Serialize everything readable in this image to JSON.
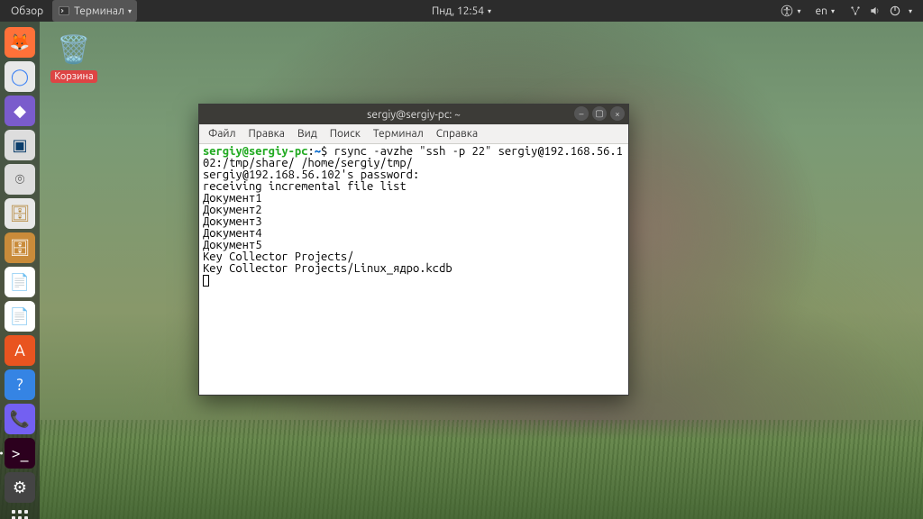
{
  "topbar": {
    "activities": "Обзор",
    "app_indicator": "Терминал",
    "clock": "Пнд, 12:54",
    "lang": "en"
  },
  "desktop": {
    "trash_label": "Корзина"
  },
  "dock": {
    "items": [
      {
        "name": "firefox",
        "bg": "#ff7139",
        "glyph": "🦊"
      },
      {
        "name": "chromium",
        "bg": "#e8e8e8",
        "glyph": "◯",
        "fg": "#4285f4"
      },
      {
        "name": "gnome-app",
        "bg": "#7a5ccc",
        "glyph": "◆"
      },
      {
        "name": "virtualbox",
        "bg": "#ddd",
        "glyph": "▣",
        "fg": "#0a3d6b"
      },
      {
        "name": "disks",
        "bg": "#ddd",
        "glyph": "⌾",
        "fg": "#555"
      },
      {
        "name": "files",
        "bg": "#e8e8e8",
        "glyph": "🗄",
        "fg": "#b58638"
      },
      {
        "name": "archive",
        "bg": "#c98b3a",
        "glyph": "🗄"
      },
      {
        "name": "writer",
        "bg": "#fff",
        "glyph": "📄",
        "fg": "#1565c0"
      },
      {
        "name": "impress",
        "bg": "#fff",
        "glyph": "📄",
        "fg": "#1565c0"
      },
      {
        "name": "software",
        "bg": "#e95420",
        "glyph": "A"
      },
      {
        "name": "help",
        "bg": "#3584e4",
        "glyph": "?"
      },
      {
        "name": "viber",
        "bg": "#7360f2",
        "glyph": "📞"
      },
      {
        "name": "terminal",
        "bg": "#2c001e",
        "glyph": ">_",
        "running": true
      },
      {
        "name": "settings",
        "bg": "#444",
        "glyph": "⚙"
      }
    ]
  },
  "terminal": {
    "title": "sergiy@sergiy-pc: ~",
    "menu": [
      "Файл",
      "Правка",
      "Вид",
      "Поиск",
      "Терминал",
      "Справка"
    ],
    "prompt_user": "sergiy@sergiy-pc",
    "prompt_sep": ":",
    "prompt_path": "~",
    "prompt_end": "$ ",
    "command": "rsync -avzhe \"ssh -p 22\" sergiy@192.168.56.102:/tmp/share/ /home/sergiy/tmp/",
    "output": [
      "sergiy@192.168.56.102's password:",
      "receiving incremental file list",
      "Документ1",
      "Документ2",
      "Документ3",
      "Документ4",
      "Документ5",
      "Key Collector Projects/",
      "Key Collector Projects/Linux_ядро.kcdb"
    ]
  }
}
